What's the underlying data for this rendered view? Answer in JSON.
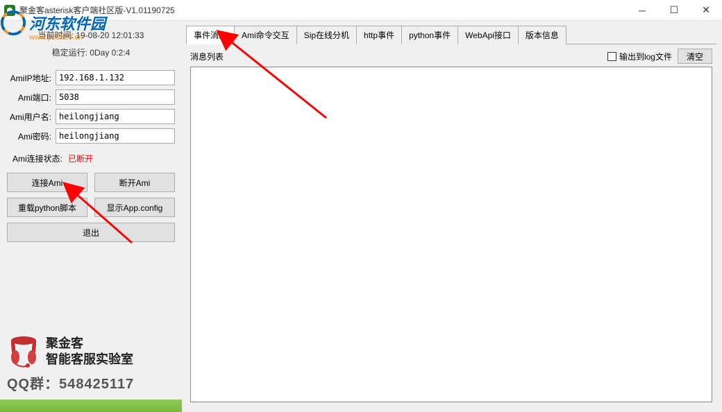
{
  "window": {
    "title": "聚金客asterisk客户端社区版-V1.01190725"
  },
  "watermark": {
    "brand": "河东软件园",
    "url": "www.pc0359.cn"
  },
  "left": {
    "current_time_label": "当前时间:",
    "current_time_value": "19-08-20    12:01:33",
    "uptime_label": "稳定运行:",
    "uptime_value": "0Day 0:2:4",
    "fields": {
      "ami_ip_label": "AmiIP地址:",
      "ami_ip_value": "192.168.1.132",
      "ami_port_label": "Ami端口:",
      "ami_port_value": "5038",
      "ami_user_label": "Ami用户名:",
      "ami_user_value": "heilongjiang",
      "ami_pass_label": "Ami密码:",
      "ami_pass_value": "heilongjiang"
    },
    "status_label": "Ami连接状态:",
    "status_value": "已断开",
    "buttons": {
      "connect": "连接Ami",
      "disconnect": "断开Ami",
      "reload_py": "重载python脚本",
      "show_config": "显示App.config",
      "exit": "退出"
    },
    "brand": {
      "name": "聚金客",
      "subtitle": "智能客服实验室",
      "qq_label": "QQ群：",
      "qq_number": "548425117"
    }
  },
  "tabs": [
    {
      "id": "tab-events",
      "label": "事件消息",
      "active": true
    },
    {
      "id": "tab-ami-cmd",
      "label": "Ami命令交互",
      "active": false
    },
    {
      "id": "tab-sip",
      "label": "Sip在线分机",
      "active": false
    },
    {
      "id": "tab-http",
      "label": "http事件",
      "active": false
    },
    {
      "id": "tab-python",
      "label": "python事件",
      "active": false
    },
    {
      "id": "tab-webapi",
      "label": "WebApi接口",
      "active": false
    },
    {
      "id": "tab-version",
      "label": "版本信息",
      "active": false
    }
  ],
  "content": {
    "msg_list_label": "消息列表",
    "log_checkbox_label": "输出到log文件",
    "clear_button": "清空"
  }
}
